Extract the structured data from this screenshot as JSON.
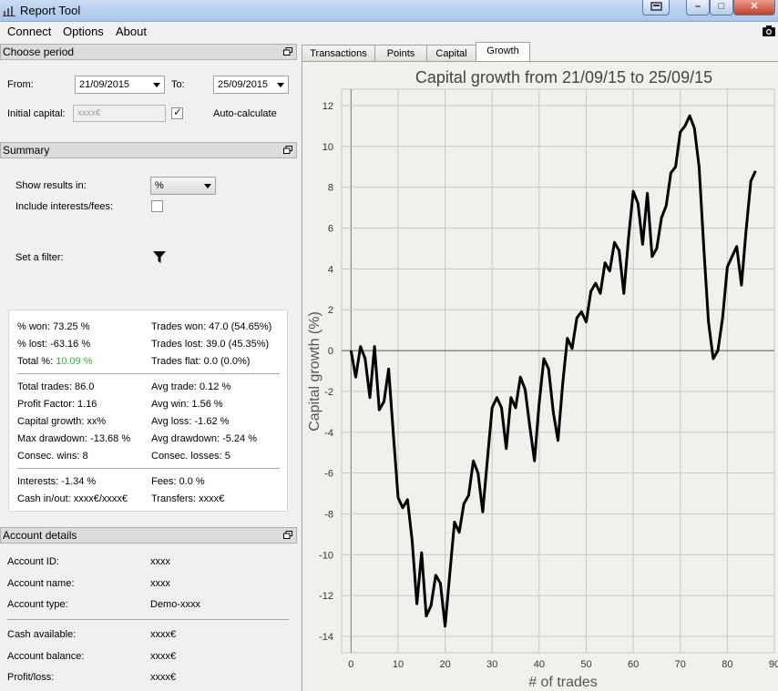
{
  "window": {
    "title": "Report Tool",
    "minimize": "–",
    "maximize": "□",
    "close": "✕"
  },
  "menu": {
    "connect": "Connect",
    "options": "Options",
    "about": "About"
  },
  "choose_period": {
    "header": "Choose period",
    "from_label": "From:",
    "from_value": "21/09/2015",
    "to_label": "To:",
    "to_value": "25/09/2015",
    "initial_capital_label": "Initial capital:",
    "initial_capital_placeholder": "xxxx€",
    "auto_calculate_label": "Auto-calculate",
    "auto_calculate_checked": true
  },
  "summary": {
    "header": "Summary",
    "show_results_label": "Show results in:",
    "show_results_value": "%",
    "include_fees_label": "Include interests/fees:",
    "include_fees_checked": false,
    "filter_label": "Set a filter:",
    "won_pct": "% won: 73.25 %",
    "trades_won": "Trades won: 47.0 (54.65%)",
    "lost_pct": "% lost: -63.16 %",
    "trades_lost": "Trades lost: 39.0 (45.35%)",
    "total_pct_label": "Total %:",
    "total_pct_value": "10.09 %",
    "trades_flat": "Trades flat: 0.0 (0.0%)",
    "total_trades": "Total trades: 86.0",
    "avg_trade": "Avg trade: 0.12 %",
    "profit_factor": "Profit Factor: 1.16",
    "avg_win": "Avg win: 1.56 %",
    "capital_growth": "Capital growth: xx%",
    "avg_loss": "Avg loss: -1.62 %",
    "max_drawdown": "Max drawdown: -13.68 %",
    "avg_drawdown": "Avg drawdown: -5.24 %",
    "consec_wins": "Consec. wins: 8",
    "consec_losses": "Consec. losses: 5",
    "interests": "Interests: -1.34 %",
    "fees": "Fees: 0.0 %",
    "cash_inout": "Cash in/out: xxxx€/xxxx€",
    "transfers": "Transfers: xxxx€"
  },
  "account": {
    "header": "Account details",
    "id_label": "Account ID:",
    "id_value": "xxxx",
    "name_label": "Account name:",
    "name_value": "xxxx",
    "type_label": "Account type:",
    "type_value": "Demo-xxxx",
    "cash_label": "Cash available:",
    "cash_value": "xxxx€",
    "balance_label": "Account balance:",
    "balance_value": "xxxx€",
    "pl_label": "Profit/loss:",
    "pl_value": "xxxx€"
  },
  "tabs": {
    "transactions": "Transactions",
    "points": "Points",
    "capital": "Capital",
    "growth": "Growth"
  },
  "colors": {
    "positive": "#33b533",
    "line": "#000000"
  },
  "icons": {
    "app": "chart-icon",
    "float": "float-panel-icon",
    "filter": "funnel-icon",
    "camera": "camera-icon"
  },
  "chart_data": {
    "type": "line",
    "title": "Capital growth from 21/09/15 to 25/09/15",
    "xlabel": "# of trades",
    "ylabel": "Capital growth (%)",
    "xlim": [
      -2,
      90
    ],
    "ylim": [
      -14.8,
      12.8
    ],
    "x_ticks": [
      0,
      10,
      20,
      30,
      40,
      50,
      60,
      70,
      80,
      90
    ],
    "y_ticks": [
      -14,
      -12,
      -10,
      -8,
      -6,
      -4,
      -2,
      0,
      2,
      4,
      6,
      8,
      10,
      12
    ],
    "grid": true,
    "series": [
      {
        "x": [
          0,
          1,
          2,
          3,
          4,
          5,
          6,
          7,
          8,
          9,
          10,
          11,
          12,
          13,
          14,
          15,
          16,
          17,
          18,
          19,
          20,
          21,
          22,
          23,
          24,
          25,
          26,
          27,
          28,
          29,
          30,
          31,
          32,
          33,
          34,
          35,
          36,
          37,
          38,
          39,
          40,
          41,
          42,
          43,
          44,
          45,
          46,
          47,
          48,
          49,
          50,
          51,
          52,
          53,
          54,
          55,
          56,
          57,
          58,
          59,
          60,
          61,
          62,
          63,
          64,
          65,
          66,
          67,
          68,
          69,
          70,
          71,
          72,
          73,
          74,
          75,
          76,
          77,
          78,
          79,
          80,
          81,
          82,
          83,
          84,
          85,
          86
        ],
        "y": [
          0.0,
          -1.3,
          0.2,
          -0.4,
          -2.3,
          0.2,
          -2.9,
          -2.5,
          -0.9,
          -4.1,
          -7.2,
          -7.7,
          -7.3,
          -9.3,
          -12.4,
          -9.9,
          -13.0,
          -12.5,
          -11.0,
          -11.4,
          -13.5,
          -10.9,
          -8.4,
          -8.9,
          -7.5,
          -7.1,
          -5.4,
          -6.0,
          -7.9,
          -5.3,
          -2.8,
          -2.3,
          -2.8,
          -4.8,
          -2.3,
          -2.8,
          -1.3,
          -1.9,
          -3.7,
          -5.4,
          -2.6,
          -0.4,
          -0.9,
          -3.0,
          -4.4,
          -1.6,
          0.6,
          0.1,
          1.6,
          1.9,
          1.4,
          2.9,
          3.3,
          2.8,
          4.3,
          3.9,
          5.3,
          4.9,
          2.8,
          5.5,
          7.8,
          7.2,
          5.2,
          7.7,
          4.6,
          5.0,
          6.5,
          7.1,
          8.7,
          9.0,
          10.7,
          11.0,
          11.5,
          10.9,
          9.0,
          5.0,
          1.4,
          -0.4,
          0.0,
          1.6,
          4.1,
          4.6,
          5.1,
          3.2,
          5.9,
          8.3,
          8.8
        ]
      }
    ]
  }
}
